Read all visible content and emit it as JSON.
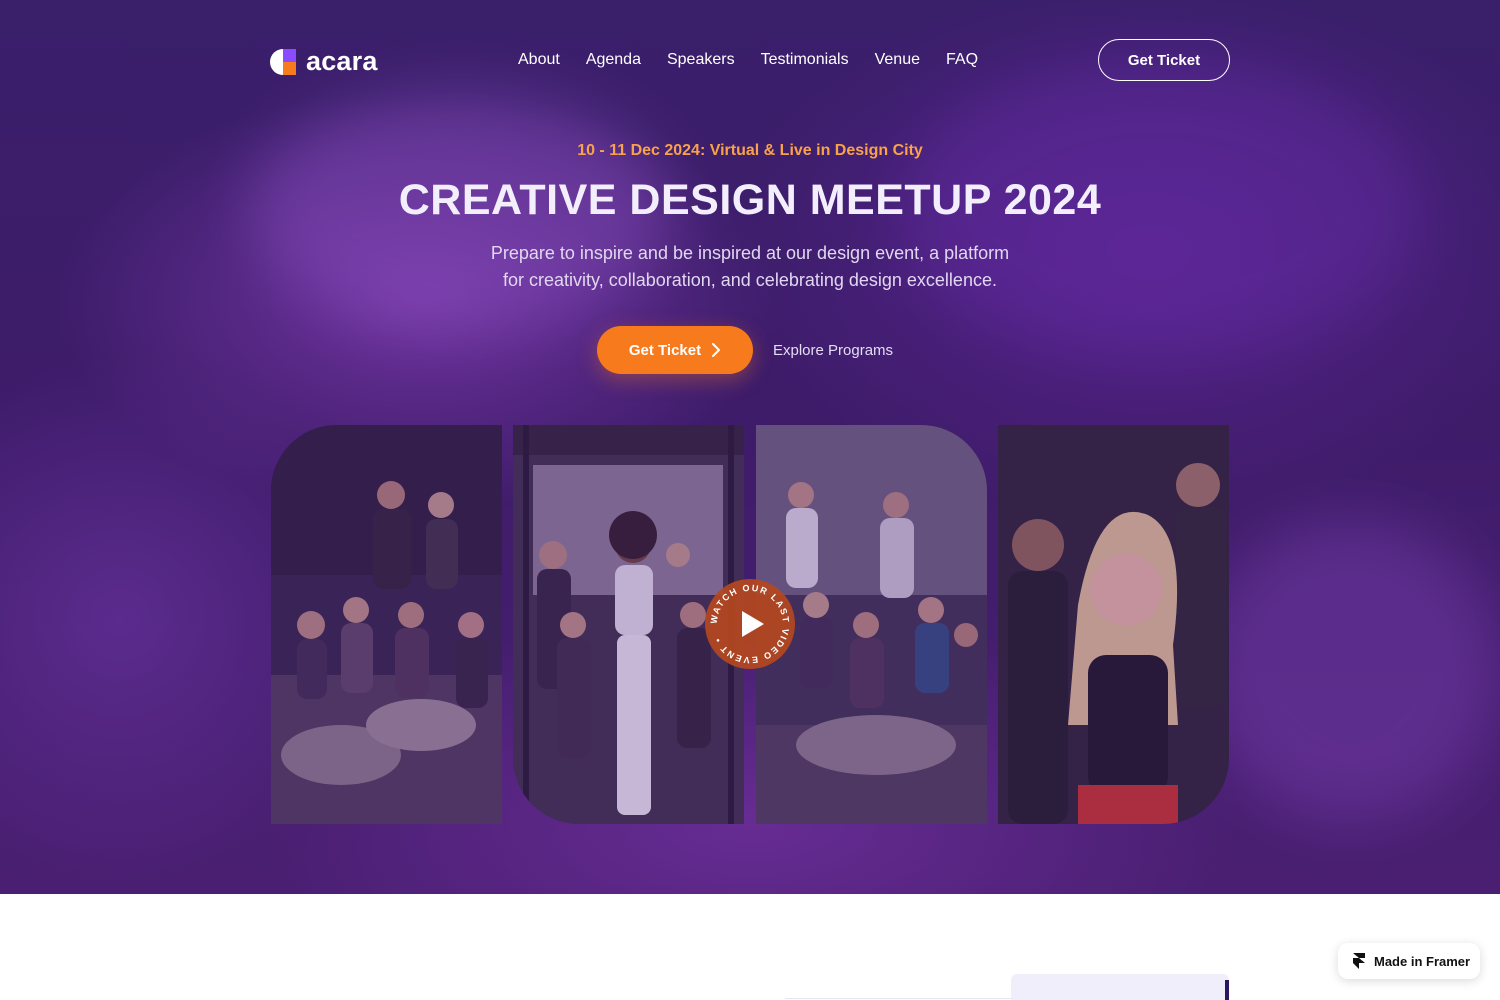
{
  "brand": {
    "name": "acara",
    "logo_icon": "acara-logo-icon"
  },
  "nav": {
    "items": [
      {
        "label": "About"
      },
      {
        "label": "Agenda"
      },
      {
        "label": "Speakers"
      },
      {
        "label": "Testimonials"
      },
      {
        "label": "Venue"
      },
      {
        "label": "FAQ"
      }
    ],
    "cta_label": "Get Ticket"
  },
  "hero": {
    "eyebrow": "10 - 11 Dec 2024: Virtual & Live in Design City",
    "title": "CREATIVE DESIGN MEETUP 2024",
    "description_line1": "Prepare to inspire and be inspired at our design event, a platform",
    "description_line2": "for creativity, collaboration, and celebrating design excellence.",
    "primary_cta": "Get Ticket",
    "secondary_cta": "Explore Programs"
  },
  "video_badge": {
    "text": "WATCH OUR LAST VIDEO EVENT • ",
    "icon": "play-icon"
  },
  "gallery": {
    "photos": [
      "event-photo-1",
      "event-photo-2",
      "event-photo-3",
      "event-photo-4"
    ]
  },
  "framer_badge": {
    "label": "Made in Framer",
    "icon": "framer-icon"
  },
  "colors": {
    "accent": "#f77b1c",
    "eyebrow": "#f9a24a",
    "hero_bg": "#3e1c6a",
    "play_badge": "#b4481e"
  }
}
